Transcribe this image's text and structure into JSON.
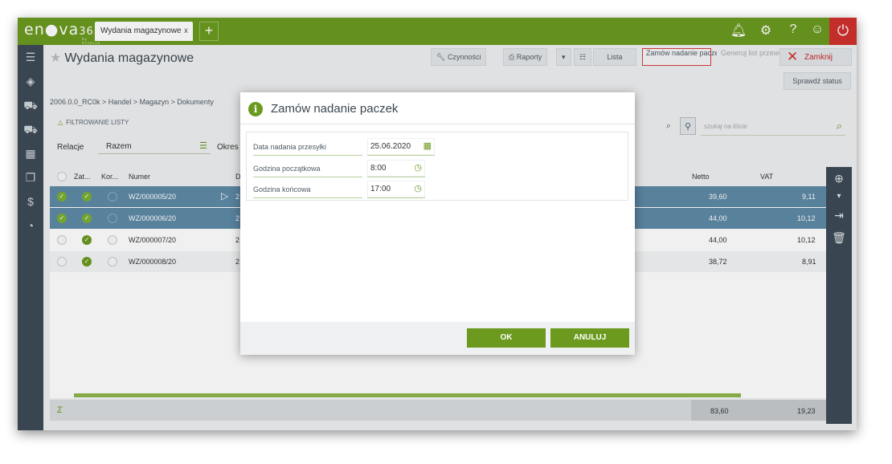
{
  "app": {
    "logo_main": "en",
    "logo_mid": "va",
    "logo_num": "365",
    "logo_sub": "by Assecco",
    "tab_label": "Wydania magazynowe",
    "tab_close": "x",
    "new_tab": "+"
  },
  "topbar_icons": [
    "bell-icon",
    "gear-icon",
    "help-icon",
    "user-icon",
    "power-icon"
  ],
  "page": {
    "title": "Wydania magazynowe",
    "breadcrumb": "2006.0.0_RC0k  >  Handel  >  Magazyn  >  Dokumenty"
  },
  "toolbar": {
    "czynnosci": "Czynności",
    "raporty": "Raporty",
    "lista": "Lista",
    "zamow": "Zamów nadanie paczek",
    "generuj": "Generuj list przewozowy",
    "zamknij": "Zamknij",
    "sprawdz": "Sprawdź status"
  },
  "filter": {
    "header": "FILTROWANIE LISTY",
    "relacje_label": "Relacje",
    "relacje_value": "Razem",
    "okres_label": "Okres",
    "search_placeholder": "szukaj na liście"
  },
  "grid": {
    "headers": {
      "zat": "Zat...",
      "kor": "Kor...",
      "numer": "Numer",
      "d": "D",
      "netto": "Netto",
      "vat": "VAT"
    },
    "rows": [
      {
        "numer": "WZ/000005/20",
        "d": "2",
        "netto": "39,60",
        "vat": "9,11",
        "selected": true,
        "check": true,
        "zat": true
      },
      {
        "numer": "WZ/000006/20",
        "d": "2",
        "netto": "44,00",
        "vat": "10,12",
        "selected": true,
        "check": true,
        "zat": true
      },
      {
        "numer": "WZ/000007/20",
        "d": "2",
        "netto": "44,00",
        "vat": "10,12",
        "selected": false,
        "check": false,
        "zat": true
      },
      {
        "numer": "WZ/000008/20",
        "d": "2",
        "netto": "38,72",
        "vat": "8,91",
        "selected": false,
        "check": false,
        "zat": true
      }
    ],
    "footer": {
      "sum_icon": "Σ",
      "netto_total": "83,60",
      "vat_total": "19,23"
    }
  },
  "modal": {
    "title": "Zamów nadanie paczek",
    "info_icon": "i",
    "fields": [
      {
        "label": "Data nadania przesyłki",
        "value": "25.06.2020",
        "icon": "calendar-icon"
      },
      {
        "label": "Godzina początkowa",
        "value": "8:00",
        "icon": "clock-icon"
      },
      {
        "label": "Godzina końcowa",
        "value": "17:00",
        "icon": "clock-icon"
      }
    ],
    "ok": "OK",
    "cancel": "ANULUJ"
  },
  "colors": {
    "brand_green": "#6b9a1f",
    "selection_blue": "#5e8aa6",
    "sidebar_dark": "#3d4a55",
    "danger_red": "#d0312d"
  }
}
